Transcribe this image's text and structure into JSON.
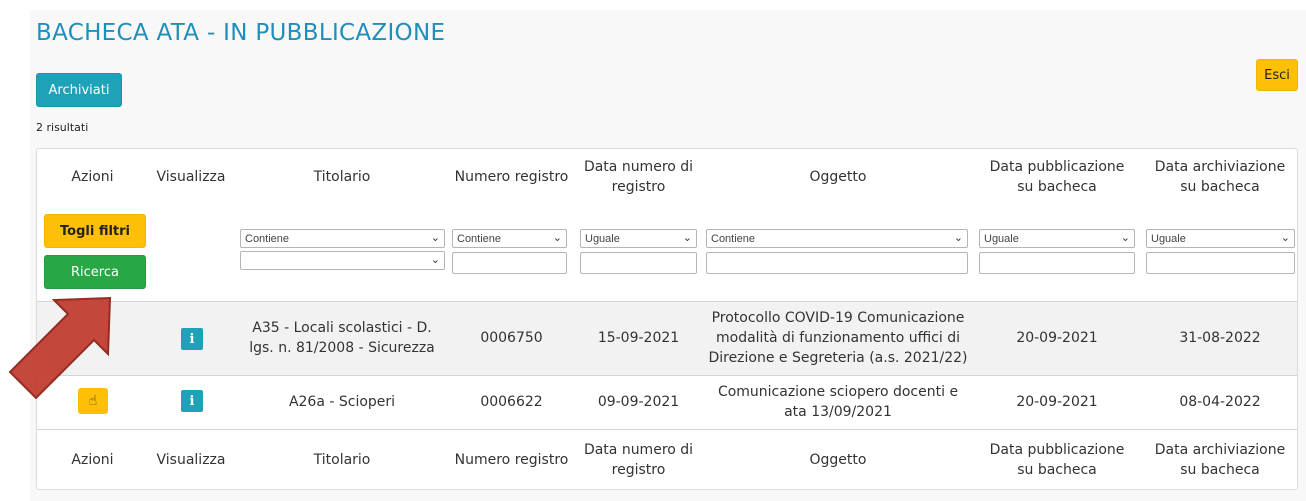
{
  "page": {
    "title": "BACHECA ATA - IN PUBBLICAZIONE",
    "results_count": "2 risultati"
  },
  "toolbar": {
    "archiviati_label": "Archiviati",
    "esci_label": "Esci"
  },
  "columns": [
    "Azioni",
    "Visualizza",
    "Titolario",
    "Numero registro",
    "Data numero di registro",
    "Oggetto",
    "Data pubblicazione su bacheca",
    "Data archiviazione su bacheca"
  ],
  "filters": {
    "togli_label": "Togli filtri",
    "ricerca_label": "Ricerca",
    "titolario_mode": "Contiene",
    "numero_mode": "Contiene",
    "data_numero_mode": "Uguale",
    "oggetto_mode": "Contiene",
    "data_pubblicazione_mode": "Uguale",
    "data_archiviazione_mode": "Uguale"
  },
  "rows": [
    {
      "titolario": "A35 - Locali scolastici - D. lgs. n. 81/2008 - Sicurezza",
      "numero": "0006750",
      "data_numero": "15-09-2021",
      "oggetto": "Protocollo COVID-19 Comunicazione modalità di funzionamento uffici di Direzione e Segreteria (a.s. 2021/22)",
      "data_pubblicazione": "20-09-2021",
      "data_archiviazione": "31-08-2022"
    },
    {
      "titolario": "A26a - Scioperi",
      "numero": "0006622",
      "data_numero": "09-09-2021",
      "oggetto": "Comunicazione sciopero docenti e ata 13/09/2021",
      "data_pubblicazione": "20-09-2021",
      "data_archiviazione": "08-04-2022"
    }
  ],
  "icons": {
    "info": "info-icon",
    "action": "hand-pointer-icon",
    "chevron": "chevron-down-icon",
    "annotation": "red-arrow-icon"
  },
  "colors": {
    "title": "#1e8fbd",
    "info": "#1fa2b7",
    "warning": "#fec006",
    "success": "#28a745",
    "arrow": "#c0392b"
  }
}
